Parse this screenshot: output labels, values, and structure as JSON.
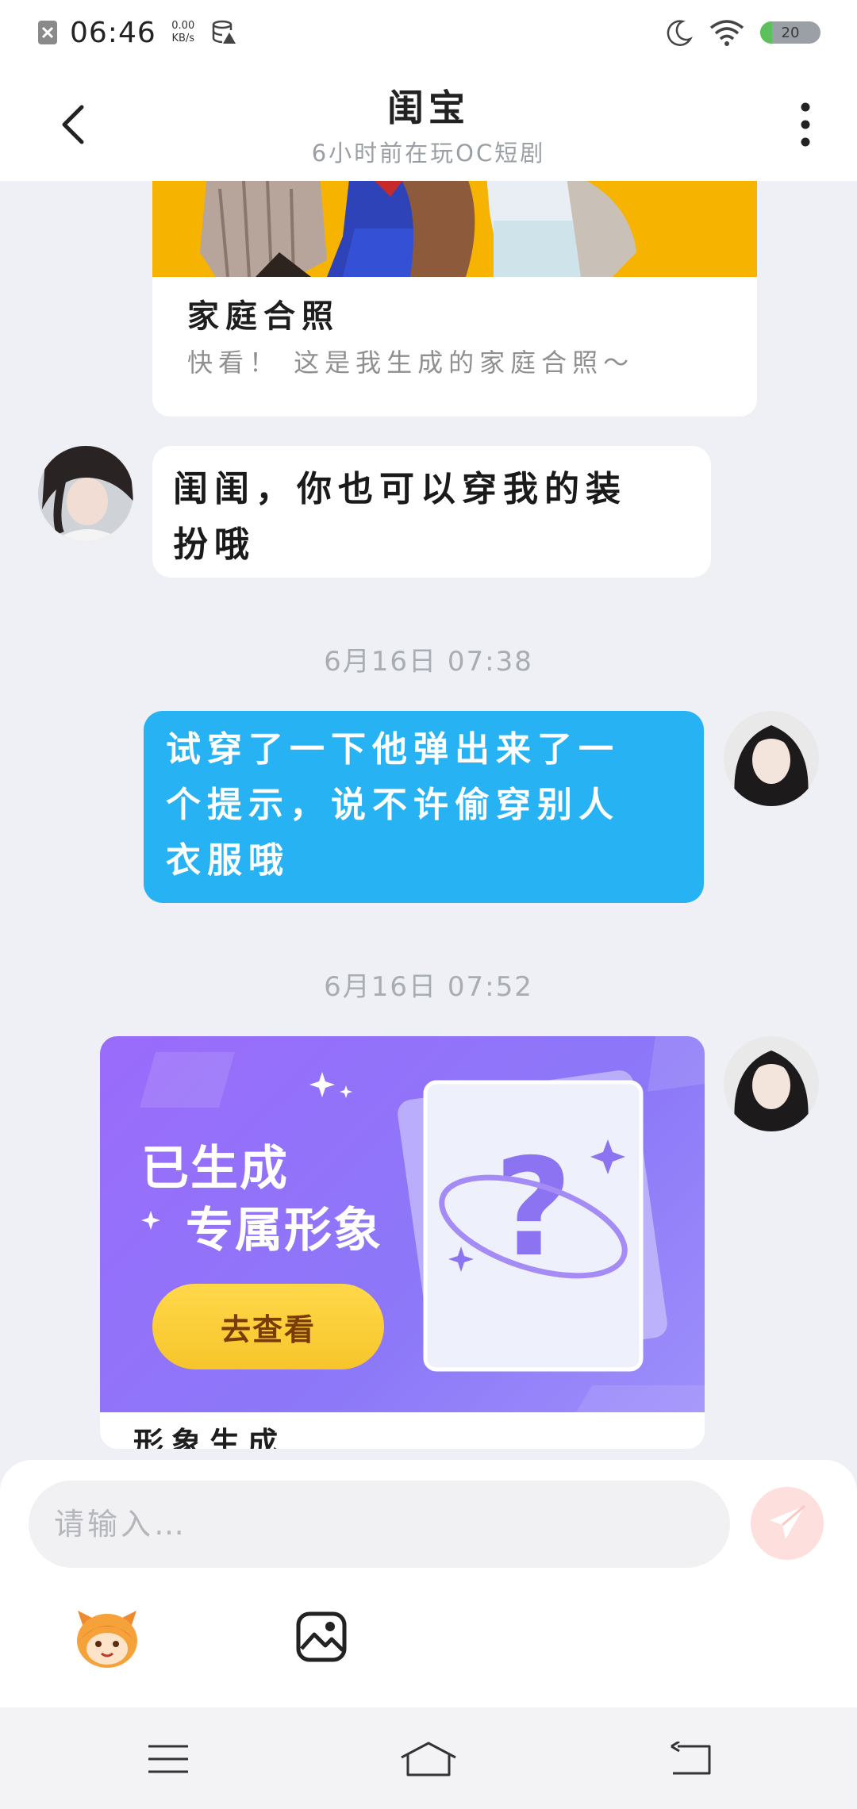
{
  "status_bar": {
    "time": "06:46",
    "net_rate": "0.00",
    "net_unit": "KB/s",
    "battery_level": "20",
    "battery_fraction": 0.2
  },
  "header": {
    "title": "闺宝",
    "subtitle": "6小时前在玩OC短剧"
  },
  "messages": [
    {
      "type": "card",
      "side": "left",
      "title": "家庭合照",
      "desc": "快看！ 这是我生成的家庭合照～"
    },
    {
      "type": "text",
      "side": "left",
      "lines": [
        "闺闺，你也可以穿我的装",
        "扮哦"
      ]
    },
    {
      "type": "time",
      "text": "6月16日  07:38"
    },
    {
      "type": "text",
      "side": "right",
      "lines": [
        "试穿了一下他弹出来了一",
        "个提示，说不许偷穿别人",
        "衣服哦"
      ]
    },
    {
      "type": "time",
      "text": "6月16日  07:52"
    },
    {
      "type": "card",
      "side": "right",
      "promo_line1": "已生成",
      "promo_line2": "专属形象",
      "promo_button": "去查看",
      "title": "形象生成"
    }
  ],
  "input": {
    "placeholder": "请输入…"
  },
  "colors": {
    "accent_blue": "#26b2f3",
    "promo_purple": "#9a6bfb",
    "button_yellow": "#ffd84a",
    "send_button": "#fde0de"
  },
  "icons": [
    "back-icon",
    "more-icon",
    "send-icon",
    "emoji-mascot-icon",
    "image-icon",
    "menu-icon",
    "home-icon",
    "back-nav-icon"
  ]
}
